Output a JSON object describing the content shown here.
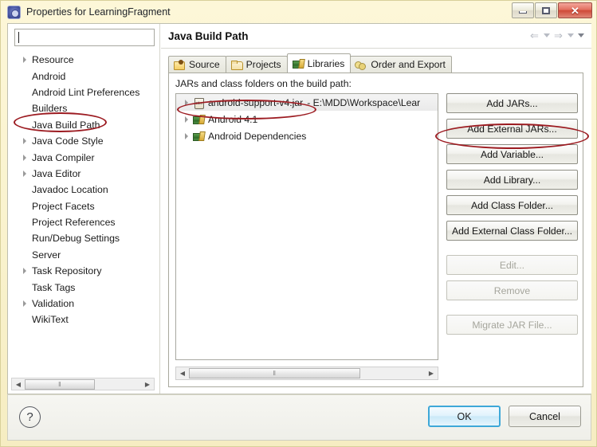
{
  "window": {
    "title": "Properties for LearningFragment",
    "icon": "eclipse-properties-icon",
    "minimize_label": "Minimize",
    "maximize_label": "Maximize",
    "close_label": "Close",
    "close_glyph": "✕"
  },
  "sidebar": {
    "filter": {
      "value": "",
      "placeholder": ""
    },
    "items": [
      {
        "label": "Resource",
        "expandable": true,
        "selected": false
      },
      {
        "label": "Android",
        "expandable": false,
        "selected": false
      },
      {
        "label": "Android Lint Preferences",
        "expandable": false,
        "selected": false
      },
      {
        "label": "Builders",
        "expandable": false,
        "selected": false
      },
      {
        "label": "Java Build Path",
        "expandable": false,
        "selected": true
      },
      {
        "label": "Java Code Style",
        "expandable": true,
        "selected": false
      },
      {
        "label": "Java Compiler",
        "expandable": true,
        "selected": false
      },
      {
        "label": "Java Editor",
        "expandable": true,
        "selected": false
      },
      {
        "label": "Javadoc Location",
        "expandable": false,
        "selected": false
      },
      {
        "label": "Project Facets",
        "expandable": false,
        "selected": false
      },
      {
        "label": "Project References",
        "expandable": false,
        "selected": false
      },
      {
        "label": "Run/Debug Settings",
        "expandable": false,
        "selected": false
      },
      {
        "label": "Server",
        "expandable": false,
        "selected": false
      },
      {
        "label": "Task Repository",
        "expandable": true,
        "selected": false
      },
      {
        "label": "Task Tags",
        "expandable": false,
        "selected": false
      },
      {
        "label": "Validation",
        "expandable": true,
        "selected": false
      },
      {
        "label": "WikiText",
        "expandable": false,
        "selected": false
      }
    ],
    "scrollbar": {
      "left_arrow": "◀",
      "right_arrow": "▶",
      "grip": "‖"
    }
  },
  "main": {
    "page_title": "Java Build Path",
    "nav": {
      "back": "⇐",
      "forward": "⇒",
      "back_icon": "back-arrow-icon",
      "forward_icon": "forward-arrow-icon",
      "menu_icon": "view-menu-icon"
    },
    "tabs": [
      {
        "label": "Source",
        "icon": "source-folder-icon",
        "active": false
      },
      {
        "label": "Projects",
        "icon": "folder-icon",
        "active": false
      },
      {
        "label": "Libraries",
        "icon": "library-icon",
        "active": true
      },
      {
        "label": "Order and Export",
        "icon": "order-export-icon",
        "active": false
      }
    ],
    "jars_label": "JARs and class folders on the build path:",
    "jar_entries": [
      {
        "name": "android-support-v4.jar",
        "path": "- E:\\MDD\\Workspace\\Lear",
        "icon": "jar-file-icon",
        "selected": true
      },
      {
        "name": "Android 4.1",
        "path": "",
        "icon": "library-icon",
        "selected": false
      },
      {
        "name": "Android Dependencies",
        "path": "",
        "icon": "library-icon",
        "selected": false
      }
    ],
    "buttons": [
      {
        "label": "Add JARs...",
        "enabled": true
      },
      {
        "label": "Add External JARs...",
        "enabled": true
      },
      {
        "label": "Add Variable...",
        "enabled": true
      },
      {
        "label": "Add Library...",
        "enabled": true
      },
      {
        "label": "Add Class Folder...",
        "enabled": true
      },
      {
        "label": "Add External Class Folder...",
        "enabled": true
      },
      {
        "label": "Edit...",
        "enabled": false
      },
      {
        "label": "Remove",
        "enabled": false
      },
      {
        "label": "Migrate JAR File...",
        "enabled": false
      }
    ],
    "scrollbar": {
      "left_arrow": "◀",
      "right_arrow": "▶",
      "grip": "‖"
    }
  },
  "footer": {
    "help_label": "?",
    "ok_label": "OK",
    "cancel_label": "Cancel"
  },
  "annotations": {
    "color": "#9c1b21",
    "highlights": [
      "Java Build Path",
      "android-support-v4.jar",
      "Add External JARs..."
    ]
  }
}
